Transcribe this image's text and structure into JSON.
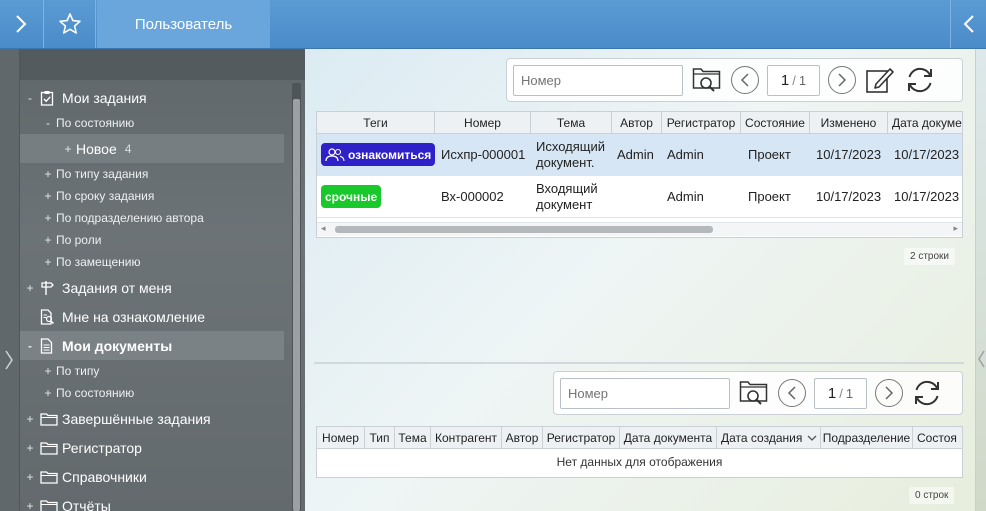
{
  "topbar": {
    "title": "Пользователь"
  },
  "sidebar": {
    "items": [
      {
        "label": "Мои задания",
        "pm": "-"
      },
      {
        "label": "По состоянию",
        "pm": "-"
      },
      {
        "label": "Новое",
        "pm": "+",
        "count": "4"
      },
      {
        "label": "По типу задания",
        "pm": "+"
      },
      {
        "label": "По сроку задания",
        "pm": "+"
      },
      {
        "label": "По подразделению автора",
        "pm": "+"
      },
      {
        "label": "По роли",
        "pm": "+"
      },
      {
        "label": "По замещению",
        "pm": "+"
      },
      {
        "label": "Задания от меня",
        "pm": "+"
      },
      {
        "label": "Мне на ознакомление",
        "pm": ""
      },
      {
        "label": "Мои документы",
        "pm": "-"
      },
      {
        "label": "По типу",
        "pm": "+"
      },
      {
        "label": "По состоянию",
        "pm": "+"
      },
      {
        "label": "Завершённые задания",
        "pm": "+"
      },
      {
        "label": "Регистратор",
        "pm": "+"
      },
      {
        "label": "Справочники",
        "pm": "+"
      },
      {
        "label": "Отчёты",
        "pm": "+"
      }
    ]
  },
  "top_panel": {
    "search_placeholder": "Номер",
    "page_current": "1",
    "page_sep": "/",
    "page_total": "1",
    "columns": [
      "Теги",
      "Номер",
      "Тема",
      "Автор",
      "Регистратор",
      "Состояние",
      "Изменено",
      "Дата докумен"
    ],
    "rows": [
      {
        "tag": "ознакомиться",
        "number": "Исхпр-000001",
        "subject": "Исходящий документ.",
        "author": "Admin",
        "registrar": "Admin",
        "state": "Проект",
        "modified": "10/17/2023",
        "doc_date": "10/17/2023"
      },
      {
        "tag": "срочные",
        "number": "Вх-000002",
        "subject": "Входящий документ",
        "author": "",
        "registrar": "Admin",
        "state": "Проект",
        "modified": "10/17/2023",
        "doc_date": "10/17/2023"
      }
    ],
    "row_count": "2 строки"
  },
  "bottom_panel": {
    "search_placeholder": "Номер",
    "page_current": "1",
    "page_sep": "/",
    "page_total": "1",
    "columns": [
      "Номер",
      "Тип",
      "Тема",
      "Контрагент",
      "Автор",
      "Регистратор",
      "Дата документа",
      "Дата создания",
      "Подразделение",
      "Состоя"
    ],
    "empty_text": "Нет данных для отображения",
    "row_count": "0 строк"
  },
  "colors": {
    "topbar": "#4a8bc9",
    "sidebar": "#656c6f",
    "tag_blue": "#2f21c8",
    "tag_green": "#19c82b"
  }
}
